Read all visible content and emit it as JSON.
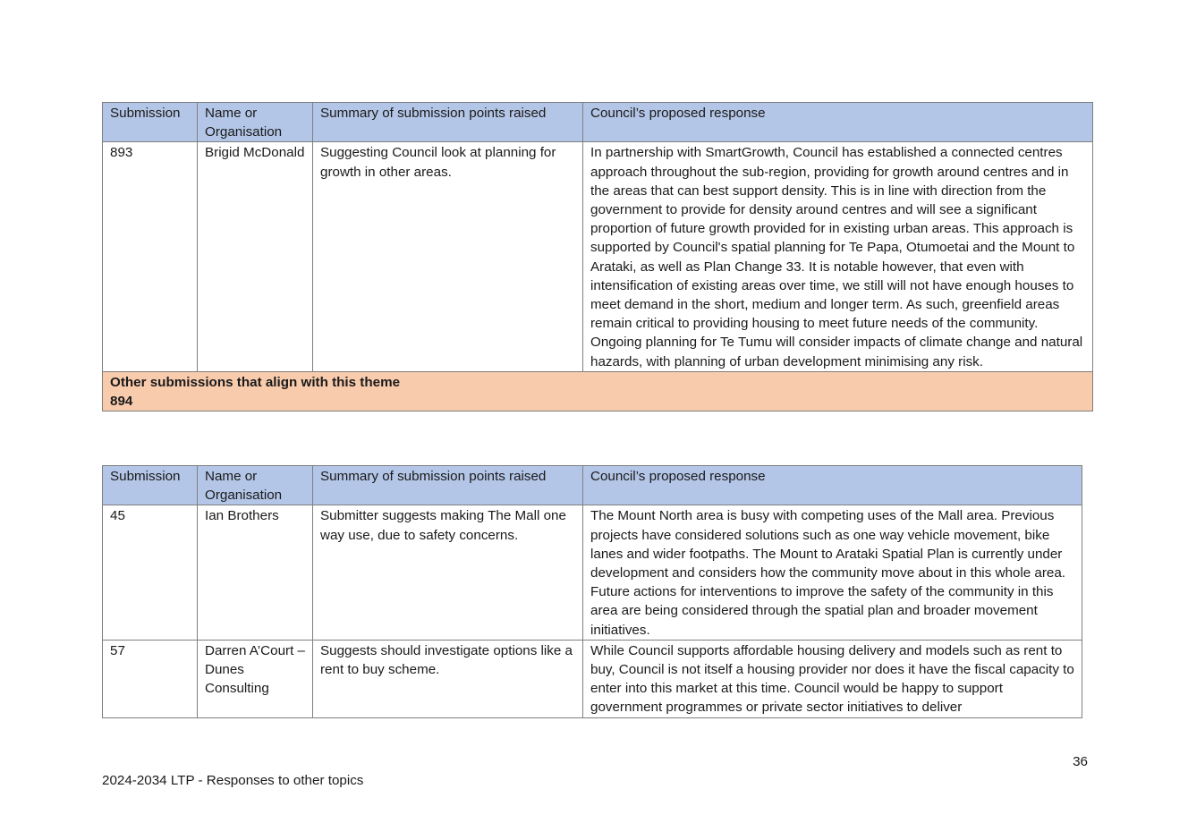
{
  "headers": {
    "submission": "Submission",
    "name": "Name or Organisation",
    "summary": "Summary of submission points raised",
    "response": "Council’s proposed response"
  },
  "table1": {
    "rows": [
      {
        "submission": "893",
        "name": "Brigid McDonald",
        "summary": "Suggesting Council look at planning for growth in other areas.",
        "response": "In partnership with SmartGrowth, Council has established a connected centres approach throughout the sub-region, providing for growth around centres and in the areas that can best support density. This is in line with direction from the government to provide for density around centres and will see a significant proportion of future growth provided for in existing urban areas. This approach is supported by Council's spatial planning for Te Papa, Otumoetai and the Mount to Arataki, as well as Plan Change 33. It is notable however, that even with intensification of existing areas over time, we still will not have enough houses to meet demand in the short, medium and longer term. As such, greenfield areas remain critical to providing housing to meet future needs of the community. Ongoing planning for Te Tumu will consider impacts of climate change and natural hazards, with planning of urban development minimising any risk."
      }
    ],
    "other_label": "Other submissions that align with this theme",
    "other_ids": "894"
  },
  "table2": {
    "rows": [
      {
        "submission": "45",
        "name": "Ian Brothers",
        "summary": "Submitter suggests making The Mall one way use, due to safety concerns.",
        "response": "The Mount North area is busy with competing uses of the Mall area. Previous projects have considered solutions such as one way vehicle movement, bike lanes and wider footpaths. The Mount to Arataki Spatial Plan is currently under development and considers how the community move about in this whole area. Future actions for interventions to improve the safety of the community in this area are being considered through the spatial plan and broader movement initiatives."
      },
      {
        "submission": "57",
        "name": "Darren A’Court – Dunes Consulting",
        "summary": "Suggests should investigate options like a rent to buy scheme.",
        "response": "While Council supports affordable housing delivery and models such as rent to buy, Council is not itself a housing provider nor does it have the fiscal capacity to enter into this market at this time.  Council would be happy to support government programmes or private sector initiatives to deliver"
      }
    ]
  },
  "footer": {
    "document_title": "2024-2034 LTP - Responses to other topics",
    "page_number": "36"
  }
}
